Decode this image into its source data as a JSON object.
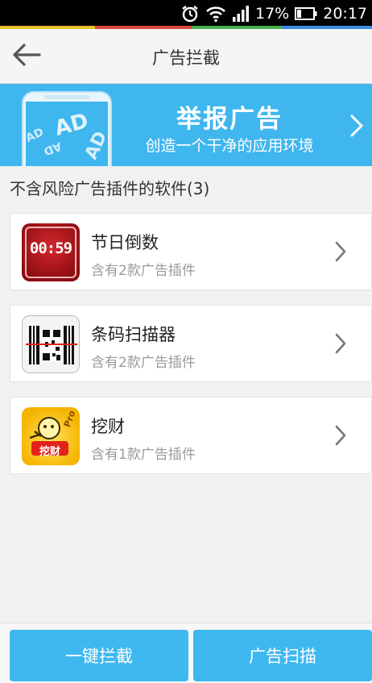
{
  "status_bar": {
    "battery_percent": "17%",
    "time": "20:17",
    "icons": [
      "alarm-icon",
      "wifi-icon",
      "signal-icon",
      "battery-icon"
    ]
  },
  "header": {
    "title": "广告拦截",
    "back_icon": "arrow-left-icon"
  },
  "banner": {
    "title": "举报广告",
    "subtitle": "创造一个干净的应用环境",
    "phone_ad_text": [
      "AD",
      "AD",
      "AD",
      "AD"
    ],
    "background_color": "#3fb6ee"
  },
  "section": {
    "title": "不含风险广告插件的软件(3)"
  },
  "apps": [
    {
      "name": "节日倒数",
      "desc": "含有2款广告插件",
      "icon": "countdown-app-icon",
      "icon_text": "00:59"
    },
    {
      "name": "条码扫描器",
      "desc": "含有2款广告插件",
      "icon": "barcode-scanner-app-icon"
    },
    {
      "name": "挖财",
      "desc": "含有1款广告插件",
      "icon": "wacai-app-icon",
      "icon_text": "挖财",
      "icon_badge": "Pro"
    }
  ],
  "bottom": {
    "left_button": "一键拦截",
    "right_button": "广告扫描"
  },
  "colors": {
    "accent": "#3fb8f0",
    "status_stripe": [
      "#e8c12b",
      "#d94a3d",
      "#4caf50",
      "#3a8de0"
    ]
  }
}
